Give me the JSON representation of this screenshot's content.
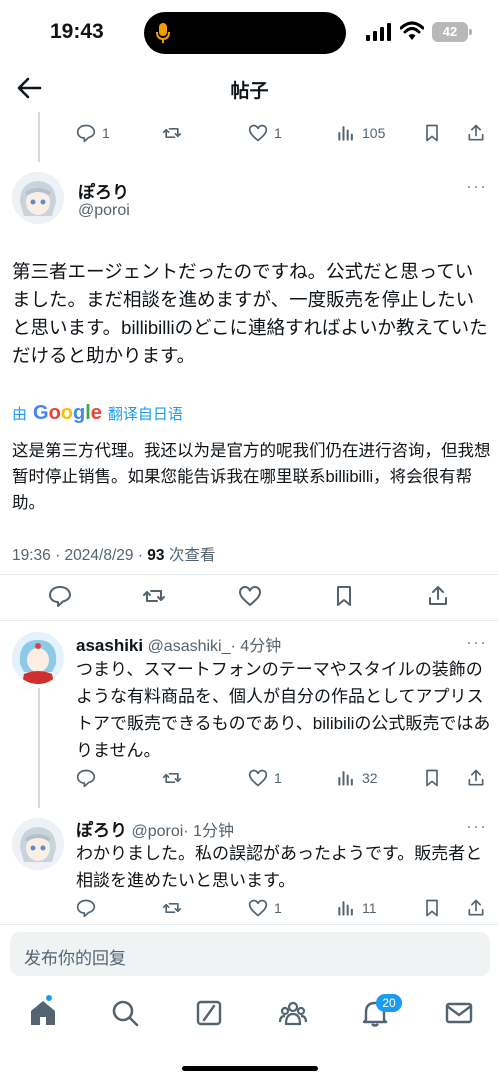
{
  "status": {
    "time": "19:43",
    "battery": "42"
  },
  "header": {
    "title": "帖子"
  },
  "prev_actions": {
    "replies": "1",
    "likes": "1",
    "views": "105"
  },
  "main_post": {
    "name": "ぽろり",
    "handle": "@poroi",
    "text": "第三者エージェントだったのですね。公式だと思っていました。まだ相談を進めますが、一度販売を停止したいと思います。billibilliのどこに連絡すればよいか教えていただけると助かります。",
    "translate_prefix": "由",
    "translate_brand": "Google",
    "translate_action": "翻译自日语",
    "translated_text": "这是第三方代理。我还以为是官方的呢我们仍在进行咨询，但我想暂时停止销售。如果您能告诉我在哪里联系billibilli，将会很有帮助。",
    "meta_time": "19:36 · 2024/8/29 · ",
    "meta_views": "93",
    "meta_views_label": " 次查看"
  },
  "replies": [
    {
      "name": "asashiki",
      "handle": "@asashiki_",
      "time": "· 4分钟",
      "text": "つまり、スマートフォンのテーマやスタイルの装飾のような有料商品を、個人が自分の作品としてアプリストアで販売できるものであり、bilibiliの公式販売ではありません。",
      "likes": "1",
      "views": "32"
    },
    {
      "name": "ぽろり",
      "handle": "@poroi",
      "time": "· 1分钟",
      "text": "わかりました。私の誤認があったようです。販売者と相談を進めたいと思います。",
      "likes": "1",
      "views": "11"
    }
  ],
  "compose": {
    "placeholder": "发布你的回复"
  },
  "nav": {
    "notifications_badge": "20"
  },
  "colors": {
    "accent": "#1d9bf0",
    "muted": "#536471",
    "text": "#0f1419"
  }
}
